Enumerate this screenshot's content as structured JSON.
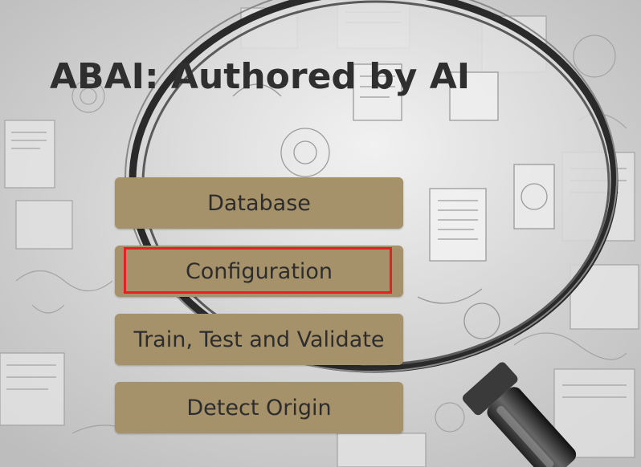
{
  "app": {
    "title": "ABAI: Authored by AI"
  },
  "menu": {
    "items": [
      {
        "label": "Database"
      },
      {
        "label": "Configuration"
      },
      {
        "label": "Train, Test and Validate"
      },
      {
        "label": "Detect Origin"
      }
    ],
    "selected_index": 1,
    "button_color": "#a5916a",
    "highlight_color": "#e22222"
  },
  "background": {
    "icon": "magnifying-glass-sketch-icon"
  }
}
